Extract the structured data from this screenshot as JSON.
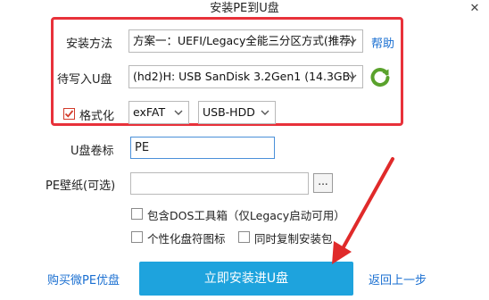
{
  "window": {
    "title": "安装PE到U盘",
    "close_glyph": "✕"
  },
  "install_method": {
    "label": "安装方法",
    "value": "方案一：UEFI/Legacy全能三分区方式(推荐)",
    "help_link": "帮助"
  },
  "target_usb": {
    "label": "待写入U盘",
    "value": "(hd2)H: USB  SanDisk 3.2Gen1 (14.3GB)",
    "refresh_icon": "refresh-icon"
  },
  "format": {
    "checkbox_label": "格式化",
    "checked": true,
    "filesystem": "exFAT",
    "mode": "USB-HDD"
  },
  "volume_label": {
    "label": "U盘卷标",
    "value": "PE"
  },
  "wallpaper": {
    "label": "PE壁纸(可选)",
    "value": "",
    "browse_label": "..."
  },
  "options": {
    "dos_tools": "包含DOS工具箱（仅Legacy启动可用）",
    "custom_icon": "个性化盘符图标",
    "copy_installer": "同时复制安装包"
  },
  "footer": {
    "buy_link": "购买微PE优盘",
    "install_button": "立即安装进U盘",
    "back_link": "返回上一步"
  },
  "colors": {
    "highlight_box": "#e8313a",
    "annotation_arrow": "#e02a2a",
    "install_button": "#1ea3dd",
    "link": "#1a6fd1",
    "refresh_icon": "#5aa22c"
  }
}
